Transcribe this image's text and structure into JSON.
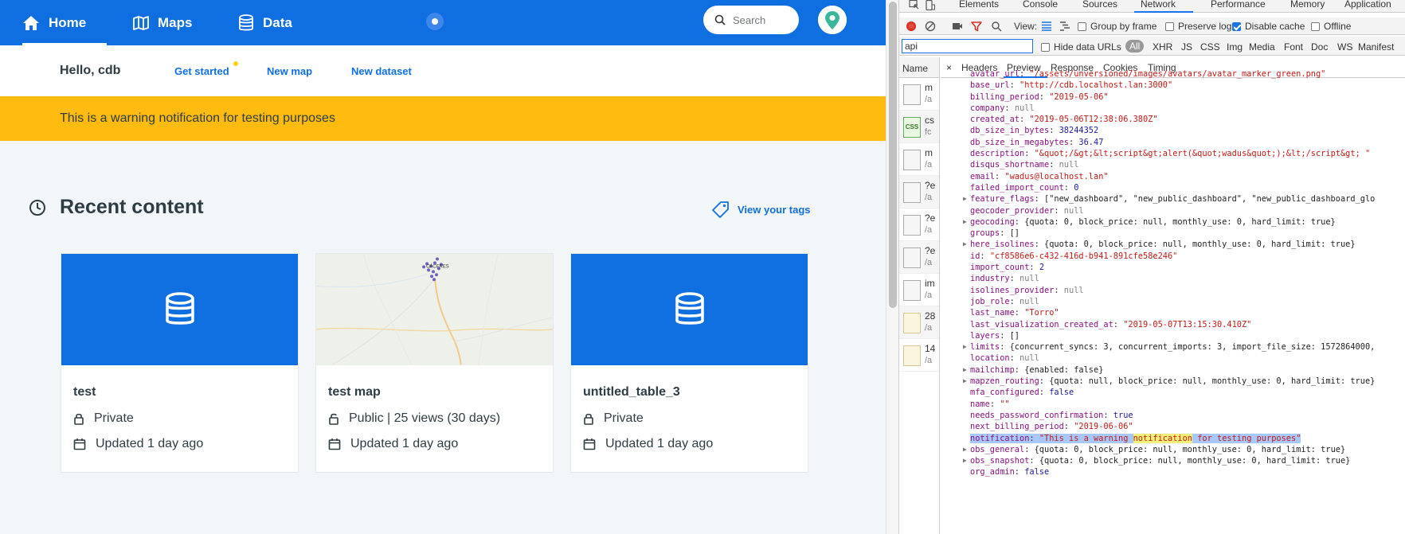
{
  "app": {
    "nav": {
      "home": "Home",
      "maps": "Maps",
      "data": "Data",
      "search_placeholder": "Search"
    },
    "subnav": {
      "greeting": "Hello, cdb",
      "get_started": "Get started",
      "new_map": "New map",
      "new_dataset": "New dataset"
    },
    "warning": "This is a warning notification for testing purposes",
    "recent": {
      "title": "Recent content",
      "view_tags": "View your tags"
    },
    "cards": [
      {
        "title": "test",
        "privacy": "Private",
        "updated": "Updated 1 day ago",
        "thumb": "dataset"
      },
      {
        "title": "test map",
        "privacy": "Public | 25 views (30 days)",
        "updated": "Updated 1 day ago",
        "thumb": "map",
        "map_label": "CÁCERES"
      },
      {
        "title": "untitled_table_3",
        "privacy": "Private",
        "updated": "Updated 1 day ago",
        "thumb": "dataset"
      }
    ],
    "colors": {
      "brand": "#0f6fe0",
      "warning": "#ffbb0f",
      "accent_dot": "#ffd400"
    }
  },
  "devtools": {
    "tabs": [
      "Elements",
      "Console",
      "Sources",
      "Network",
      "Performance",
      "Memory",
      "Application"
    ],
    "active_tab": "Network",
    "toolbar": {
      "view_label": "View:",
      "group_by_frame": "Group by frame",
      "preserve_log": "Preserve log",
      "disable_cache": "Disable cache",
      "offline": "Offline"
    },
    "filter": {
      "value": "api",
      "hide_data_urls": "Hide data URLs",
      "types": [
        "All",
        "XHR",
        "JS",
        "CSS",
        "Img",
        "Media",
        "Font",
        "Doc",
        "WS",
        "Manifest"
      ]
    },
    "list_header": "Name",
    "requests": [
      {
        "name": "m",
        "path": "/a",
        "kind": "doc"
      },
      {
        "name": "cs",
        "path": "fc",
        "kind": "css",
        "badge": "CSS"
      },
      {
        "name": "m",
        "path": "/a",
        "kind": "doc"
      },
      {
        "name": "?e",
        "path": "/a",
        "kind": "doc"
      },
      {
        "name": "?e",
        "path": "/a",
        "kind": "doc"
      },
      {
        "name": "?e",
        "path": "/a",
        "kind": "doc"
      },
      {
        "name": "im",
        "path": "/a",
        "kind": "doc"
      },
      {
        "name": "28",
        "path": "/a",
        "kind": "img"
      },
      {
        "name": "14",
        "path": "/a",
        "kind": "img"
      }
    ],
    "detail_tabs": [
      "Headers",
      "Preview",
      "Response",
      "Cookies",
      "Timing"
    ],
    "active_detail_tab": "Preview",
    "close_glyph": "×",
    "json_lines": [
      {
        "key": "avatar_url",
        "value": "\"/assets/unversioned/images/avatars/avatar_marker_green.png\"",
        "type": "s"
      },
      {
        "key": "base_url",
        "value": "\"http://cdb.localhost.lan:3000\"",
        "type": "s"
      },
      {
        "key": "billing_period",
        "value": "\"2019-05-06\"",
        "type": "s"
      },
      {
        "key": "company",
        "value": "null",
        "type": "nl"
      },
      {
        "key": "created_at",
        "value": "\"2019-05-06T12:38:06.380Z\"",
        "type": "s"
      },
      {
        "key": "db_size_in_bytes",
        "value": "38244352",
        "type": "n"
      },
      {
        "key": "db_size_in_megabytes",
        "value": "36.47",
        "type": "n"
      },
      {
        "key": "description",
        "value": "\"&quot;/&gt;&lt;script&gt;alert(&quot;wadus&quot;);&lt;/script&gt; \"",
        "type": "s"
      },
      {
        "key": "disqus_shortname",
        "value": "null",
        "type": "nl"
      },
      {
        "key": "email",
        "value": "\"wadus@localhost.lan\"",
        "type": "s"
      },
      {
        "key": "failed_import_count",
        "value": "0",
        "type": "n"
      },
      {
        "key": "feature_flags",
        "value": "[\"new_dashboard\", \"new_public_dashboard\", \"new_public_dashboard_glo",
        "type": "o",
        "expandable": true
      },
      {
        "key": "geocoder_provider",
        "value": "null",
        "type": "nl"
      },
      {
        "key": "geocoding",
        "value": "{quota: 0, block_price: null, monthly_use: 0, hard_limit: true}",
        "type": "o",
        "expandable": true
      },
      {
        "key": "groups",
        "value": "[]",
        "type": "o"
      },
      {
        "key": "here_isolines",
        "value": "{quota: 0, block_price: null, monthly_use: 0, hard_limit: true}",
        "type": "o",
        "expandable": true
      },
      {
        "key": "id",
        "value": "\"cf8586e6-c432-416d-b941-891cfe58e246\"",
        "type": "s"
      },
      {
        "key": "import_count",
        "value": "2",
        "type": "n"
      },
      {
        "key": "industry",
        "value": "null",
        "type": "nl"
      },
      {
        "key": "isolines_provider",
        "value": "null",
        "type": "nl"
      },
      {
        "key": "job_role",
        "value": "null",
        "type": "nl"
      },
      {
        "key": "last_name",
        "value": "\"Torro\"",
        "type": "s"
      },
      {
        "key": "last_visualization_created_at",
        "value": "\"2019-05-07T13:15:30.410Z\"",
        "type": "s"
      },
      {
        "key": "layers",
        "value": "[]",
        "type": "o"
      },
      {
        "key": "limits",
        "value": "{concurrent_syncs: 3, concurrent_imports: 3, import_file_size: 1572864000,",
        "type": "o",
        "expandable": true
      },
      {
        "key": "location",
        "value": "null",
        "type": "nl"
      },
      {
        "key": "mailchimp",
        "value": "{enabled: false}",
        "type": "o",
        "expandable": true
      },
      {
        "key": "mapzen_routing",
        "value": "{quota: null, block_price: null, monthly_use: 0, hard_limit: true}",
        "type": "o",
        "expandable": true
      },
      {
        "key": "mfa_configured",
        "value": "false",
        "type": "b"
      },
      {
        "key": "name",
        "value": "\"\"",
        "type": "s"
      },
      {
        "key": "needs_password_confirmation",
        "value": "true",
        "type": "b"
      },
      {
        "key": "next_billing_period",
        "value": "\"2019-06-06\"",
        "type": "s"
      },
      {
        "key": "notification",
        "value": "\"This is a warning notification for testing purposes\"",
        "type": "s",
        "highlight": true
      },
      {
        "key": "obs_general",
        "value": "{quota: 0, block_price: null, monthly_use: 0, hard_limit: true}",
        "type": "o",
        "expandable": true
      },
      {
        "key": "obs_snapshot",
        "value": "{quota: 0, block_price: null, monthly_use: 0, hard_limit: true}",
        "type": "o",
        "expandable": true
      },
      {
        "key": "org_admin",
        "value": "false",
        "type": "b"
      }
    ]
  }
}
